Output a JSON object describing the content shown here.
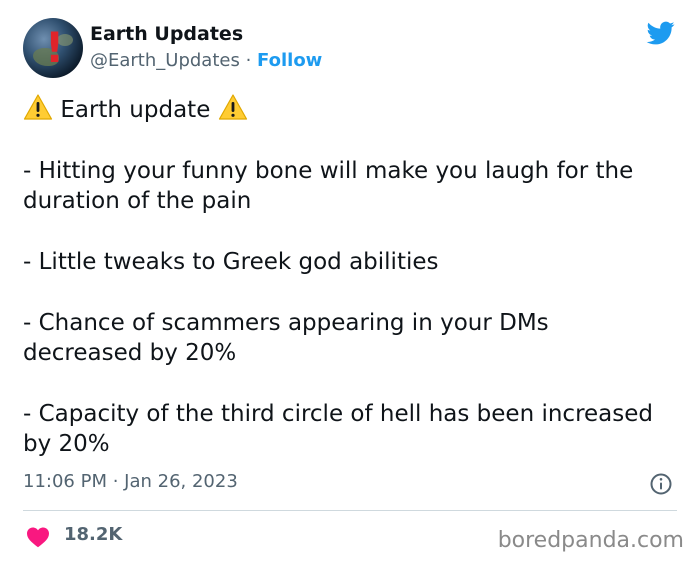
{
  "author": {
    "name": "Earth Updates",
    "handle": "@Earth_Updates",
    "separator": "·",
    "follow_label": "Follow"
  },
  "tweet": {
    "header_text": "Earth update",
    "lines": [
      "- Hitting your funny bone will make you laugh for the duration of the pain",
      "- Little tweaks to Greek god abilities",
      "- Chance of scammers appearing in your DMs decreased by 20%",
      "- Capacity of the third circle of hell has been increased by 20%"
    ],
    "timestamp": "11:06 PM · Jan 26, 2023",
    "likes": "18.2K"
  },
  "watermark": "boredpanda.com",
  "icons": {
    "platform": "twitter-bird-icon",
    "warning": "warning-icon",
    "info": "info-icon",
    "like": "heart-icon"
  },
  "colors": {
    "accent": "#1d9bf0",
    "like": "#f91880",
    "warning": "#ffcc33",
    "text": "#0f1419",
    "muted": "#536471"
  }
}
